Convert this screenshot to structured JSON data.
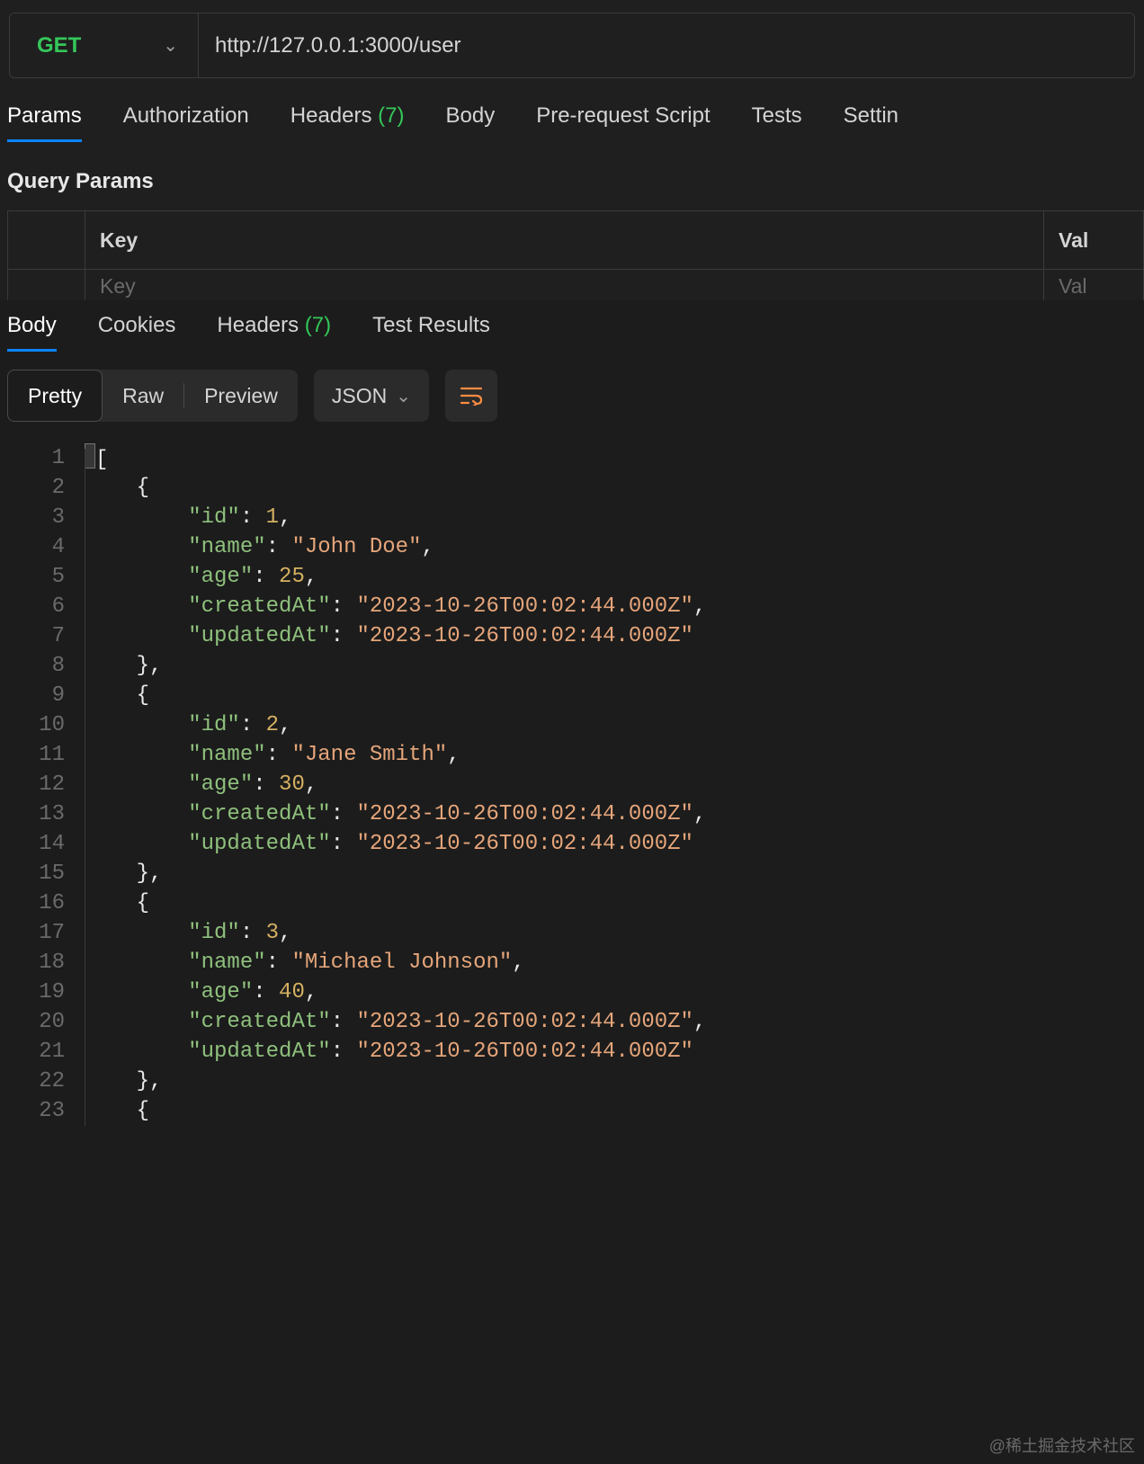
{
  "request": {
    "method": "GET",
    "url": "http://127.0.0.1:3000/user"
  },
  "request_tabs": [
    {
      "label": "Params",
      "active": true
    },
    {
      "label": "Authorization"
    },
    {
      "label": "Headers",
      "count": "(7)"
    },
    {
      "label": "Body"
    },
    {
      "label": "Pre-request Script"
    },
    {
      "label": "Tests"
    },
    {
      "label": "Settin"
    }
  ],
  "query_params": {
    "title": "Query Params",
    "columns": {
      "key": "Key",
      "value": "Val"
    },
    "placeholder": {
      "key": "Key",
      "value": "Val"
    }
  },
  "response_tabs": [
    {
      "label": "Body",
      "active": true
    },
    {
      "label": "Cookies"
    },
    {
      "label": "Headers",
      "count": "(7)"
    },
    {
      "label": "Test Results"
    }
  ],
  "format": {
    "options": [
      "Pretty",
      "Raw",
      "Preview"
    ],
    "active": "Pretty",
    "mime": "JSON"
  },
  "response_body": [
    {
      "id": 1,
      "name": "John Doe",
      "age": 25,
      "createdAt": "2023-10-26T00:02:44.000Z",
      "updatedAt": "2023-10-26T00:02:44.000Z"
    },
    {
      "id": 2,
      "name": "Jane Smith",
      "age": 30,
      "createdAt": "2023-10-26T00:02:44.000Z",
      "updatedAt": "2023-10-26T00:02:44.000Z"
    },
    {
      "id": 3,
      "name": "Michael Johnson",
      "age": 40,
      "createdAt": "2023-10-26T00:02:44.000Z",
      "updatedAt": "2023-10-26T00:02:44.000Z"
    }
  ],
  "visible_line_count": 23,
  "watermark": "@稀土掘金技术社区"
}
